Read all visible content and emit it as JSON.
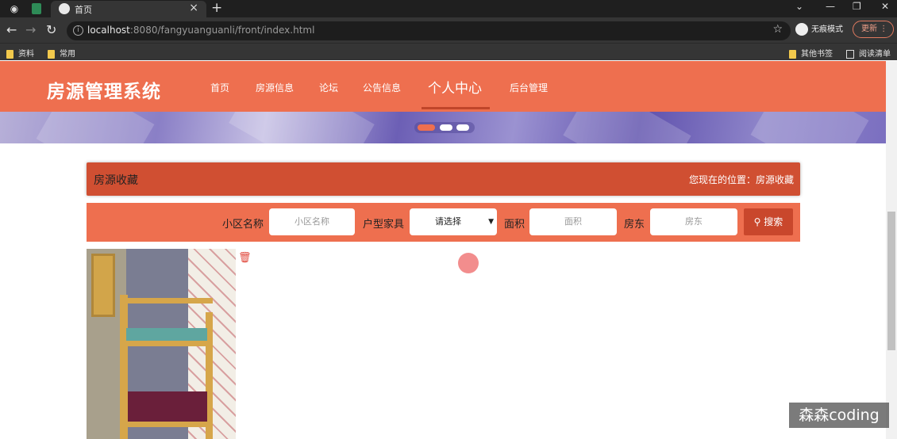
{
  "browser": {
    "tab_title": "首页",
    "url_host": "localhost",
    "url_rest": ":8080/fangyuanguanli/front/index.html",
    "incognito_label": "无痕模式",
    "update_label": "更新",
    "bookmarks": [
      "资料",
      "常用"
    ],
    "other_bookmarks": "其他书签",
    "reading_list": "阅读清单"
  },
  "site": {
    "brand": "房源管理系统",
    "nav": [
      {
        "label": "首页"
      },
      {
        "label": "房源信息"
      },
      {
        "label": "论坛"
      },
      {
        "label": "公告信息"
      },
      {
        "label": "个人中心"
      },
      {
        "label": "后台管理"
      }
    ],
    "active_nav": "个人中心"
  },
  "main": {
    "title": "房源收藏",
    "location": "您现在的位置：房源收藏",
    "search": {
      "community_label": "小区名称",
      "community_placeholder": "小区名称",
      "furniture_label": "户型家具",
      "furniture_value": "请选择",
      "area_label": "面积",
      "area_placeholder": "面积",
      "landlord_label": "房东",
      "landlord_placeholder": "房东",
      "search_button": "搜索"
    }
  },
  "overlay": {
    "watermark": "森森coding"
  },
  "colors": {
    "accent": "#ee6f4f",
    "title_bar": "#d04f32",
    "button": "#c9472c"
  }
}
